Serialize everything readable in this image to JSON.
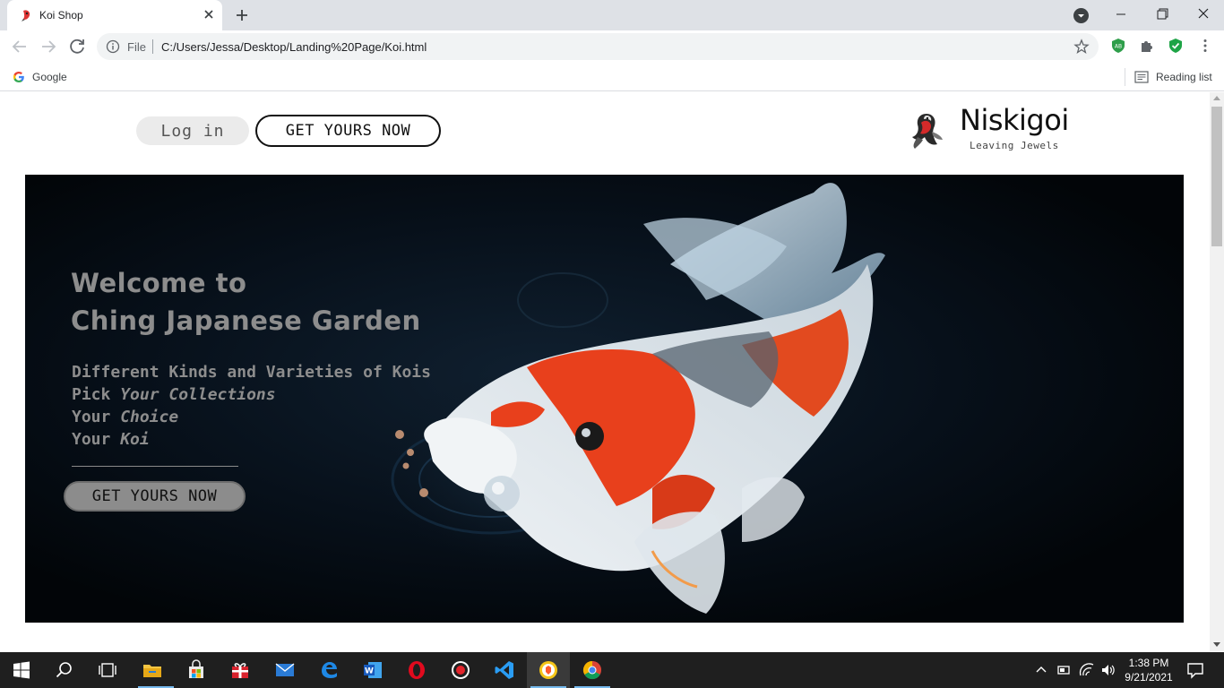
{
  "browser": {
    "tab_title": "Koi Shop",
    "omnibox_scheme": "File",
    "url": "C:/Users/Jessa/Desktop/Landing%20Page/Koi.html",
    "bookmark_google": "Google",
    "reading_list": "Reading list",
    "extension_badge": "AB"
  },
  "header": {
    "login_label": "Log in",
    "cta_label": "GET YOURS NOW",
    "brand_name": "Niskigoi",
    "brand_tagline": "Leaving Jewels"
  },
  "hero": {
    "title_line1": "Welcome to",
    "title_line2": "Ching Japanese Garden",
    "line1": "Different Kinds and Varieties of Kois",
    "line2_prefix": "Pick ",
    "line2_em": "Your Collections",
    "line3_prefix": "Your ",
    "line3_em": "Choice",
    "line4_prefix": "Your ",
    "line4_em": "Koi",
    "cta_label": "GET YOURS NOW"
  },
  "taskbar": {
    "time": "1:38 PM",
    "date": "9/21/2021"
  },
  "colors": {
    "koi_red": "#e8401c",
    "koi_white": "#e9eef2",
    "water": "#07101a",
    "hero_text": "#8d8d8d"
  }
}
